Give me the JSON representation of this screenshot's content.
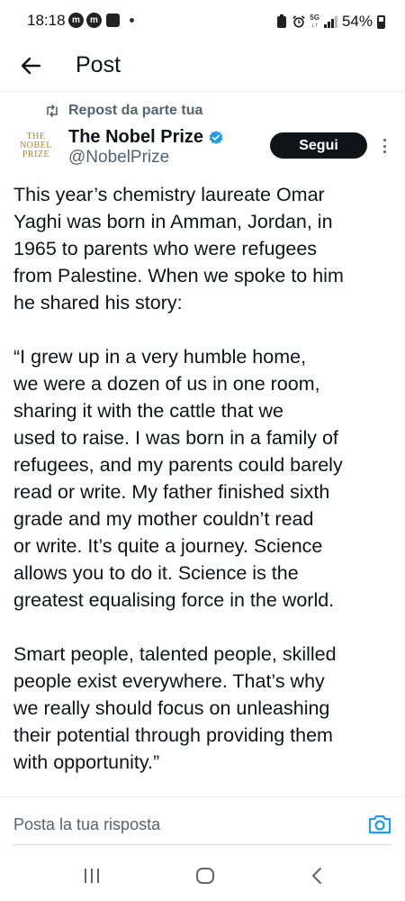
{
  "status_bar": {
    "time": "18:18",
    "badges": [
      "m",
      "m"
    ],
    "network": [
      "5G",
      "↓↑"
    ],
    "battery": "54%"
  },
  "header": {
    "title": "Post"
  },
  "repost": {
    "label": "Repost da parte tua"
  },
  "author": {
    "avatar_lines": [
      "THE",
      "NOBEL",
      "PRIZE"
    ],
    "display_name": "The Nobel Prize",
    "handle": "@NobelPrize",
    "follow_label": "Segui"
  },
  "post": {
    "paragraph_1": [
      "This year’s chemistry laureate Omar",
      "Yaghi was born in Amman, Jordan, in",
      "1965 to parents who were refugees",
      "from Palestine. When we spoke to him",
      "he shared his story:"
    ],
    "paragraph_2": [
      "“I grew up in a very humble home,",
      "we were a dozen of us in one room,",
      "sharing it with the cattle that we",
      "used to raise. I was born in a family of",
      "refugees, and my parents could barely",
      "read or write. My father finished sixth",
      "grade and my mother couldn’t read",
      "or write. It’s quite a journey. Science",
      "allows you to do it. Science is the",
      "greatest equalising force in the world."
    ],
    "paragraph_3": [
      "Smart people, talented people, skilled",
      "people exist everywhere. That’s why",
      "we really should focus on unleashing",
      "their potential through providing them",
      "with opportunity.”"
    ]
  },
  "reply": {
    "placeholder": "Posta la tua risposta"
  },
  "colors": {
    "text_primary": "#0f1419",
    "text_secondary": "#536471",
    "verified_blue": "#1d9bf0",
    "camera_blue": "#1d9bf0",
    "nobel_gold": "#b5822b",
    "follow_bg": "#0f1419"
  },
  "icons": {
    "back": "arrow-left-icon",
    "repost": "repost-icon",
    "verified": "verified-badge-icon",
    "more": "vertical-dots-icon",
    "camera": "camera-icon",
    "nav_recents": "recents-icon",
    "nav_home": "home-icon",
    "nav_back": "chevron-left-icon"
  }
}
